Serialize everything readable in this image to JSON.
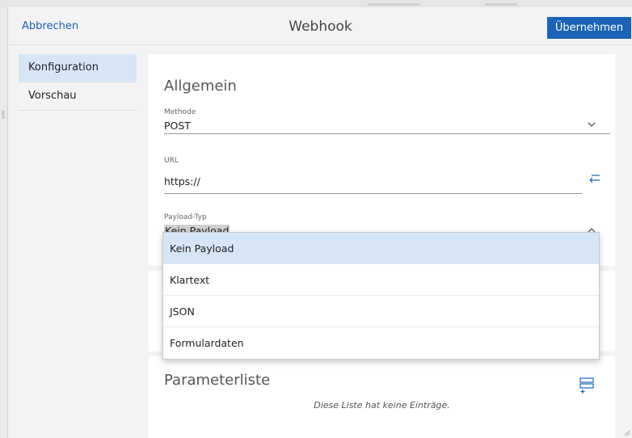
{
  "header": {
    "cancel_label": "Abbrechen",
    "title": "Webhook",
    "apply_label": "Übernehmen"
  },
  "nav": {
    "items": [
      {
        "label": "Konfiguration",
        "active": true
      },
      {
        "label": "Vorschau",
        "active": false
      }
    ]
  },
  "general": {
    "title": "Allgemein",
    "method": {
      "label": "Methode",
      "value": "POST"
    },
    "url": {
      "label": "URL",
      "value": "https://"
    },
    "payload_type": {
      "label": "Payload-Typ",
      "value": "Kein Payload"
    }
  },
  "payload_dropdown": {
    "options": [
      "Kein Payload",
      "Klartext",
      "JSON",
      "Formulardaten"
    ],
    "selected_index": 0
  },
  "parameters": {
    "title": "Parameterliste",
    "empty_message": "Diese Liste hat keine Einträge."
  },
  "icons": {
    "method_chevron": "chevron-down-icon",
    "payload_chevron": "chevron-up-icon",
    "url_action": "return-arrow-icon",
    "add_parameter": "add-list-item-icon",
    "resize": "resize-grip-icon"
  },
  "colors": {
    "accent": "#1a63b8",
    "selection": "#d6e6f7"
  }
}
